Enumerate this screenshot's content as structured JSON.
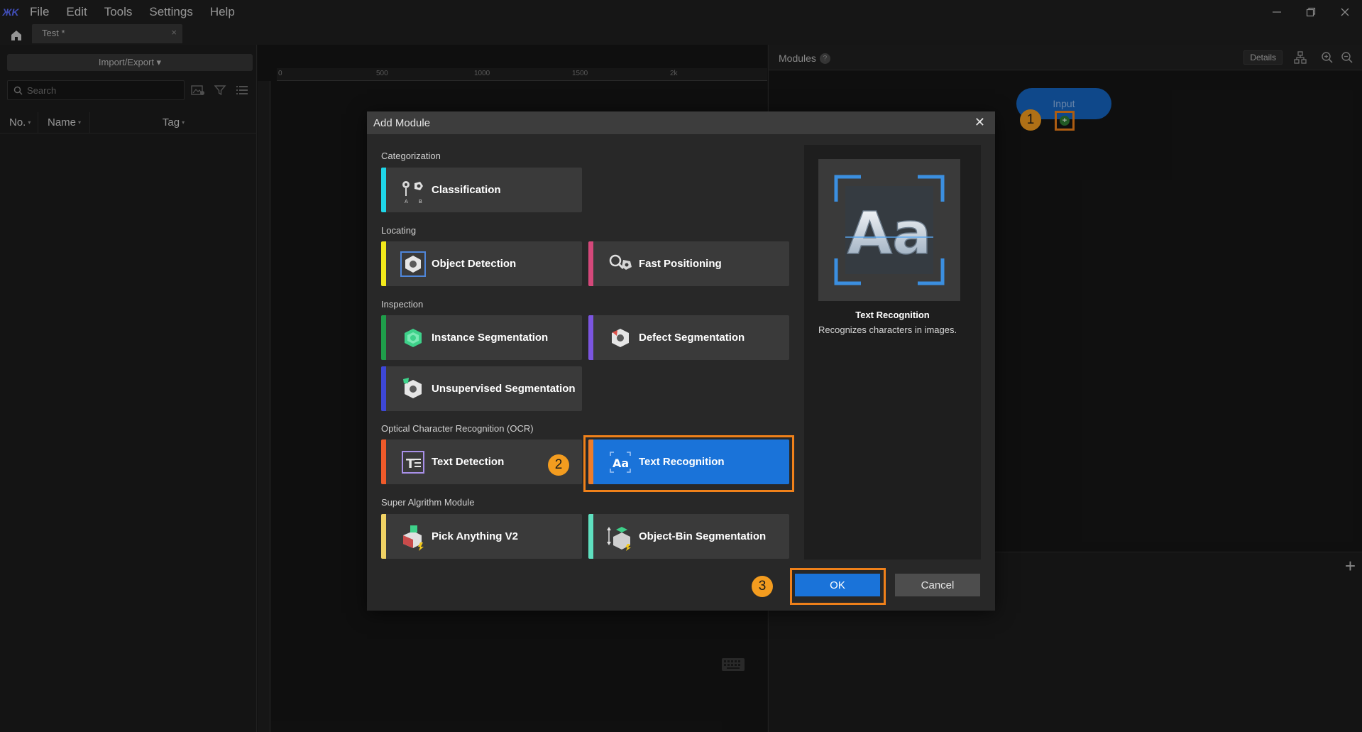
{
  "app": {
    "logo_text": "ЖK",
    "menu": [
      "File",
      "Edit",
      "Tools",
      "Settings",
      "Help"
    ]
  },
  "tabs": [
    {
      "label": "Test *",
      "close": "×"
    }
  ],
  "left_panel": {
    "import_export_label": "Import/Export ▾",
    "search_placeholder": "Search",
    "columns": [
      "No.",
      "Name",
      "Tag"
    ]
  },
  "canvas": {
    "ruler_top_ticks": [
      "0",
      "500",
      "1000",
      "1500",
      "2k"
    ]
  },
  "modules_panel": {
    "title": "Modules",
    "help_glyph": "?",
    "details_label": "Details",
    "input_node_label": "Input",
    "add_port_glyph": "+",
    "lower_plus": "+"
  },
  "steps": [
    "1",
    "2",
    "3"
  ],
  "dialog": {
    "title": "Add Module",
    "close_glyph": "✕",
    "categories": [
      {
        "label": "Categorization",
        "modules": [
          {
            "name": "Classification",
            "icon": "classification-icon",
            "accent": "#1fd6e8"
          }
        ]
      },
      {
        "label": "Locating",
        "modules": [
          {
            "name": "Object Detection",
            "icon": "object-detection-icon",
            "accent": "#f2e81b"
          },
          {
            "name": "Fast Positioning",
            "icon": "fast-positioning-icon",
            "accent": "#d4487a"
          }
        ]
      },
      {
        "label": "Inspection",
        "modules": [
          {
            "name": "Instance Segmentation",
            "icon": "instance-segmentation-icon",
            "accent": "#1f9e4a"
          },
          {
            "name": "Defect Segmentation",
            "icon": "defect-segmentation-icon",
            "accent": "#7b55e0"
          },
          {
            "name": "Unsupervised Segmentation",
            "icon": "unsupervised-segmentation-icon",
            "accent": "#3d47d6"
          }
        ]
      },
      {
        "label": "Optical Character Recognition (OCR)",
        "modules": [
          {
            "name": "Text Detection",
            "icon": "text-detection-icon",
            "accent": "#ef5a2a"
          },
          {
            "name": "Text Recognition",
            "icon": "text-recognition-icon",
            "accent": "#ef7d2a",
            "selected": true
          }
        ]
      },
      {
        "label": "Super Algrithm Module",
        "modules": [
          {
            "name": "Pick Anything V2",
            "icon": "pick-anything-icon",
            "accent": "#f0d264"
          },
          {
            "name": "Object-Bin Segmentation",
            "icon": "object-bin-segmentation-icon",
            "accent": "#5fe0c0"
          }
        ]
      }
    ],
    "preview": {
      "image_text": "Aa",
      "name": "Text Recognition",
      "description": "Recognizes characters in images."
    },
    "ok_label": "OK",
    "cancel_label": "Cancel"
  },
  "colors": {
    "accent_blue": "#1a73d9",
    "highlight_orange": "#f0811a",
    "badge_orange": "#f39c1f"
  }
}
